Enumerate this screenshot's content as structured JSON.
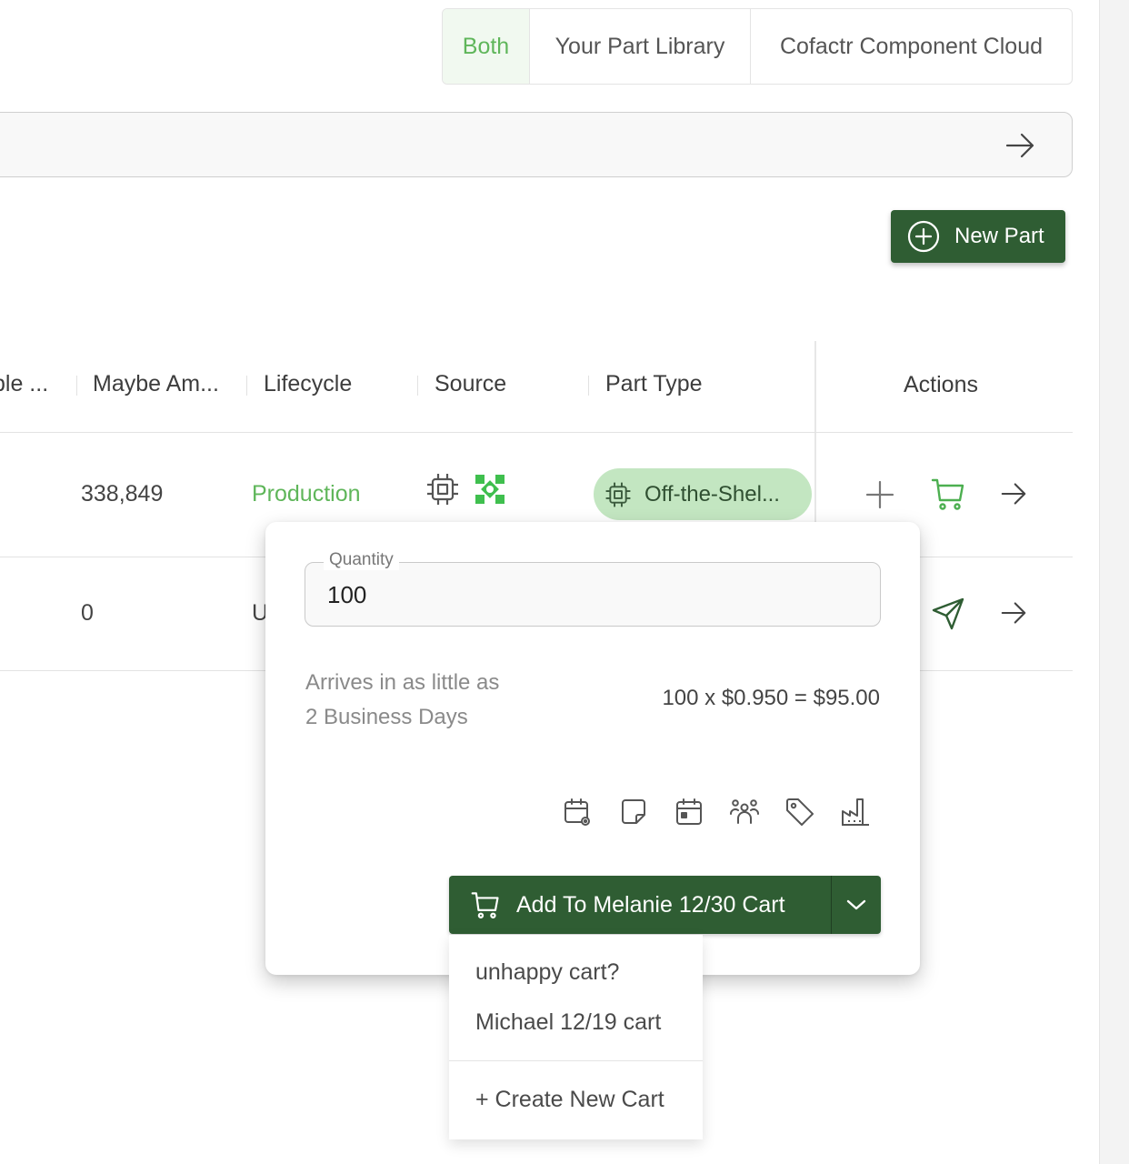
{
  "source_toggle": {
    "options": [
      "Both",
      "Your Part Library",
      "Cofactr Component Cloud"
    ],
    "active": "Both"
  },
  "search": {
    "value": "",
    "submit_icon": "arrow-right-icon"
  },
  "new_part": {
    "label": "New Part",
    "icon": "plus-circle-icon"
  },
  "table": {
    "columns": [
      "ble ...",
      "Maybe Am...",
      "Lifecycle",
      "Source",
      "Part Type",
      "Actions"
    ],
    "rows": [
      {
        "maybe_amount": "338,849",
        "lifecycle": "Production",
        "source_icons": [
          "chip-icon",
          "cofactr-logo-icon"
        ],
        "part_type": "Off-the-Shel...",
        "actions": [
          "plus-icon",
          "cart-icon",
          "arrow-right-icon"
        ]
      },
      {
        "maybe_amount": "0",
        "lifecycle": "U",
        "actions": [
          "send-icon",
          "arrow-right-icon"
        ]
      }
    ]
  },
  "popover": {
    "quantity_label": "Quantity",
    "quantity_value": "100",
    "arrives_line1": "Arrives in as little as",
    "arrives_line2": "2 Business Days",
    "price_calc": "100 x $0.950 = $95.00",
    "tool_icons": [
      "calendar-pin-icon",
      "sticky-note-icon",
      "calendar-icon",
      "users-icon",
      "tag-icon",
      "factory-icon"
    ],
    "add_to_cart_label": "Add To Melanie 12/30 Cart"
  },
  "cart_menu": {
    "items": [
      "unhappy cart?",
      "Michael 12/19 cart"
    ],
    "create_label": "+ Create New Cart"
  },
  "colors": {
    "brand_dark_green": "#2f5d33",
    "accent_green": "#5fb65a",
    "badge_green": "#c3e6c1"
  }
}
